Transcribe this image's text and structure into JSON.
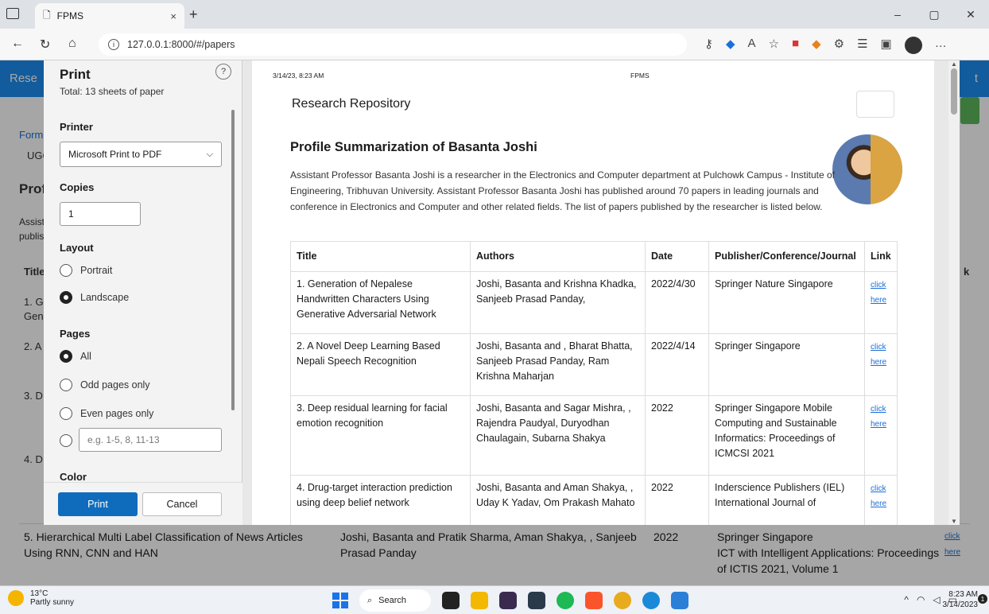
{
  "browser": {
    "tab_title": "FPMS",
    "tab_close": "×",
    "new_tab": "+",
    "url": "127.0.0.1:8000/#/papers",
    "win_min": "–",
    "win_max": "▢",
    "win_close": "✕"
  },
  "background_page": {
    "header_left": "Rese",
    "header_right": "t",
    "format_link": "Form",
    "select_value": "UGC",
    "profile_heading": "Prof",
    "assist_text": "Assist",
    "publis_text": "publis",
    "col_title": "Title",
    "col_link": "k",
    "row1": "1. G",
    "row1b": "Gen",
    "row2": "2. A",
    "row3": "3. D",
    "row4": "4. D",
    "row5_title": "5. Hierarchical Multi Label Classification of News Articles Using RNN, CNN and HAN",
    "row5_authors": "Joshi, Basanta and Pratik Sharma, Aman Shakya, , Sanjeeb Prasad Panday",
    "row5_date": "2022",
    "row5_pub1": "Springer Singapore",
    "row5_pub2": "ICT with Intelligent Applications: Proceedings of ICTIS 2021, Volume 1",
    "row5_link": "click here"
  },
  "print_dialog": {
    "title": "Print",
    "subtitle": "Total: 13 sheets of paper",
    "help": "?",
    "printer_label": "Printer",
    "printer_value": "Microsoft Print to PDF",
    "copies_label": "Copies",
    "copies_value": "1",
    "layout_label": "Layout",
    "layout_portrait": "Portrait",
    "layout_landscape": "Landscape",
    "pages_label": "Pages",
    "pages_all": "All",
    "pages_odd": "Odd pages only",
    "pages_even": "Even pages only",
    "pages_range_placeholder": "e.g. 1-5, 8, 11-13",
    "color_label": "Color",
    "print_button": "Print",
    "cancel_button": "Cancel"
  },
  "preview": {
    "date": "3/14/23, 8:23 AM",
    "doc_title": "FPMS",
    "repo_heading": "Research Repository",
    "profile_heading": "Profile Summarization of Basanta Joshi",
    "summary": "Assistant Professor Basanta Joshi is a researcher in the Electronics and Computer department at Pulchowk Campus - Institute of Engineering, Tribhuvan University. Assistant Professor Basanta Joshi has published around 70 papers in leading journals and conference in Electronics and Computer and other related fields. The list of papers published by the researcher is listed below.",
    "columns": [
      "Title",
      "Authors",
      "Date",
      "Publisher/Conference/Journal",
      "Link"
    ],
    "rows": [
      {
        "title": "1. Generation of Nepalese Handwritten Characters Using Generative Adversarial Network",
        "authors": "Joshi, Basanta and Krishna Khadka, Sanjeeb Prasad Panday,",
        "date": "2022/4/30",
        "publisher": "Springer Nature Singapore",
        "link": "click here"
      },
      {
        "title": "2. A Novel Deep Learning Based Nepali Speech Recognition",
        "authors": "Joshi, Basanta and , Bharat Bhatta, Sanjeeb Prasad Panday, Ram Krishna Maharjan",
        "date": "2022/4/14",
        "publisher": "Springer Singapore",
        "link": "click here"
      },
      {
        "title": "3. Deep residual learning for facial emotion recognition",
        "authors": "Joshi, Basanta and Sagar Mishra, , Rajendra Paudyal, Duryodhan Chaulagain, Subarna Shakya",
        "date": "2022",
        "publisher": "Springer Singapore Mobile Computing and Sustainable Informatics: Proceedings of ICMCSI 2021",
        "link": "click here"
      },
      {
        "title": "4. Drug-target interaction prediction using deep belief network",
        "authors": "Joshi, Basanta and Aman Shakya, , Uday K Yadav, Om Prakash Mahato",
        "date": "2022",
        "publisher": "Inderscience Publishers (IEL) International Journal of",
        "link": "click here"
      }
    ]
  },
  "taskbar": {
    "temp": "13°C",
    "weather": "Partly sunny",
    "search": "Search",
    "time": "8:23 AM",
    "date": "3/14/2023",
    "notif_count": "1"
  }
}
